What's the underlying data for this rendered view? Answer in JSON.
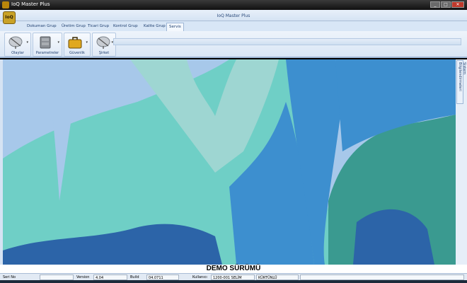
{
  "window": {
    "title": "IoQ Master Plus",
    "buttons": [
      "_",
      "□",
      "✕"
    ]
  },
  "ribbon": {
    "title": "IoQ Master Plus",
    "logo_text": "IoQ",
    "tabs": [
      {
        "label": "Dokuman Grup",
        "active": false
      },
      {
        "label": "Üretim Grup",
        "active": false
      },
      {
        "label": "Ticari Grup",
        "active": false
      },
      {
        "label": "Kontrol Grup",
        "active": false
      },
      {
        "label": "Kalite Grup",
        "active": false
      },
      {
        "label": "Servis",
        "active": true
      }
    ],
    "groups": [
      {
        "label": "Olaylar",
        "icon": "satellite-dish-icon"
      },
      {
        "label": "Parametreler",
        "icon": "server-icon"
      },
      {
        "label": "Güvenlik",
        "icon": "briefcase-icon"
      },
      {
        "label": "Şirket",
        "icon": "satellite-dish-icon"
      }
    ]
  },
  "side_tab": {
    "label": "Sistem Bilgilendirmeleri"
  },
  "demo_banner": "DEMO SÜRÜMÜ",
  "status": {
    "seri_no_label": "Seri No",
    "seri_no_value": "",
    "version_label": "Version",
    "version_value": "4.04",
    "build_label": "Build",
    "build_value": "04.0711",
    "user_label": "Kullanıcı",
    "user_value": "1200-001 SELİM",
    "user_surname": "KÜRTÜNLÜ"
  },
  "colors": {
    "sky": "#a7c8ea",
    "teal": "#6fcfc6",
    "light_teal": "#9ed6d2",
    "mid_blue": "#3d8fcf",
    "deep_blue": "#2c64a8",
    "dark_teal": "#3a9a90"
  }
}
